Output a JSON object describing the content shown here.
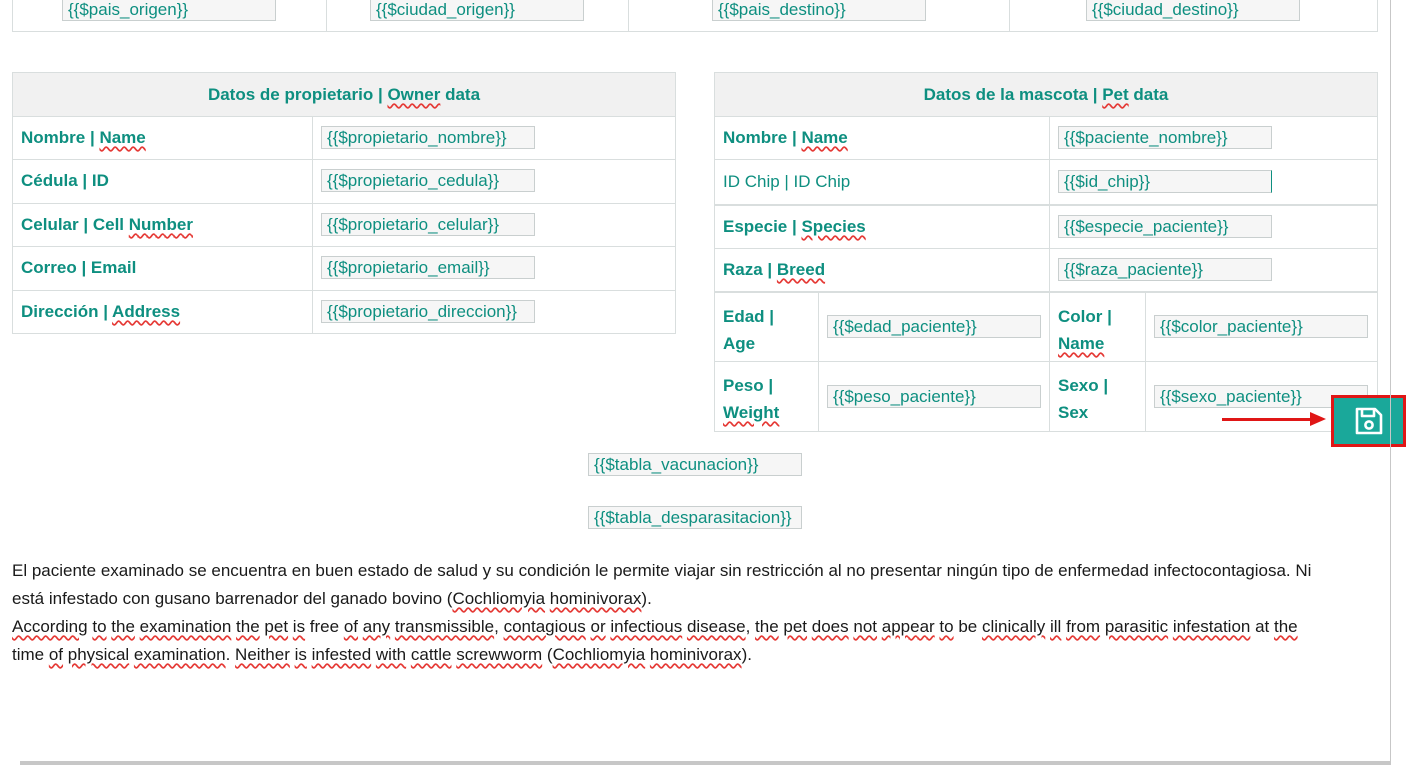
{
  "top_row": {
    "pais_origen": "{{$pais_origen}}",
    "ciudad_origen": "{{$ciudad_origen}}",
    "pais_destino": "{{$pais_destino}}",
    "ciudad_destino": "{{$ciudad_destino}}"
  },
  "owner_table": {
    "header_es": "Datos de propietario | ",
    "header_en1": "Owner",
    "header_en2": " data",
    "rows": [
      {
        "label_a": "Nombre | ",
        "label_b": "Name",
        "field": "{{$propietario_nombre}}"
      },
      {
        "label_a": "Cédula | ID",
        "label_b": "",
        "field": "{{$propietario_cedula}}"
      },
      {
        "label_a": "Celular | Cell ",
        "label_b": "Number",
        "field": "{{$propietario_celular}}"
      },
      {
        "label_a": "Correo | Email",
        "label_b": "",
        "field": "{{$propietario_email}}"
      },
      {
        "label_a": "Dirección | ",
        "label_b": "Address",
        "field": "{{$propietario_direccion}}"
      }
    ]
  },
  "pet_table": {
    "header_es": "Datos de la mascota | ",
    "header_en1": "Pet",
    "header_en2": " data",
    "rows": [
      {
        "label_a": "Nombre | ",
        "label_b": "Name",
        "field": "{{$paciente_nombre}}"
      },
      {
        "label_a": "ID Chip | ID Chip",
        "label_b": "",
        "field": "{{$id_chip}}"
      },
      {
        "label_a": "Especie | ",
        "label_b": "Species",
        "field": "{{$especie_paciente}}"
      },
      {
        "label_a": "Raza | ",
        "label_b": "Breed",
        "field": "{{$raza_paciente}}"
      }
    ],
    "edad_l1": "Edad |",
    "edad_l2": "Age",
    "edad_field": "{{$edad_paciente}}",
    "color_l1": "Color |",
    "color_l2": "Name",
    "color_field": "{{$color_paciente}}",
    "peso_l1": "Peso |",
    "peso_l2": "Weight",
    "peso_field": "{{$peso_paciente}}",
    "sexo_l1": "Sexo |",
    "sexo_l2": "Sex",
    "sexo_field": "{{$sexo_paciente}}"
  },
  "tabla_vacunacion": "{{$tabla_vacunacion}}",
  "tabla_desparasitacion": "{{$tabla_desparasitacion}}",
  "paragraph_es_1": "El paciente examinado se encuentra en buen estado de salud y su condición le permite viajar sin restricción al no presentar ningún tipo de enfermedad infectocontagiosa. Ni",
  "paragraph_es_2": "está infestado con gusano barrenador del ganado bovino (Cochliomyia hominivorax).",
  "paragraph_en_1": "According to the examination the pet is free of any transmissible, contagious or infectious disease, the pet does not appear to be clinically ill from parasitic infestation at the",
  "paragraph_en_2": "time of physical examination. Neither is infested with cattle screwworm (Cochliomyia hominivorax).",
  "save_button": {
    "icon": "floppy-disk-icon",
    "color": "#1aa89a",
    "highlight": "#e01616"
  }
}
